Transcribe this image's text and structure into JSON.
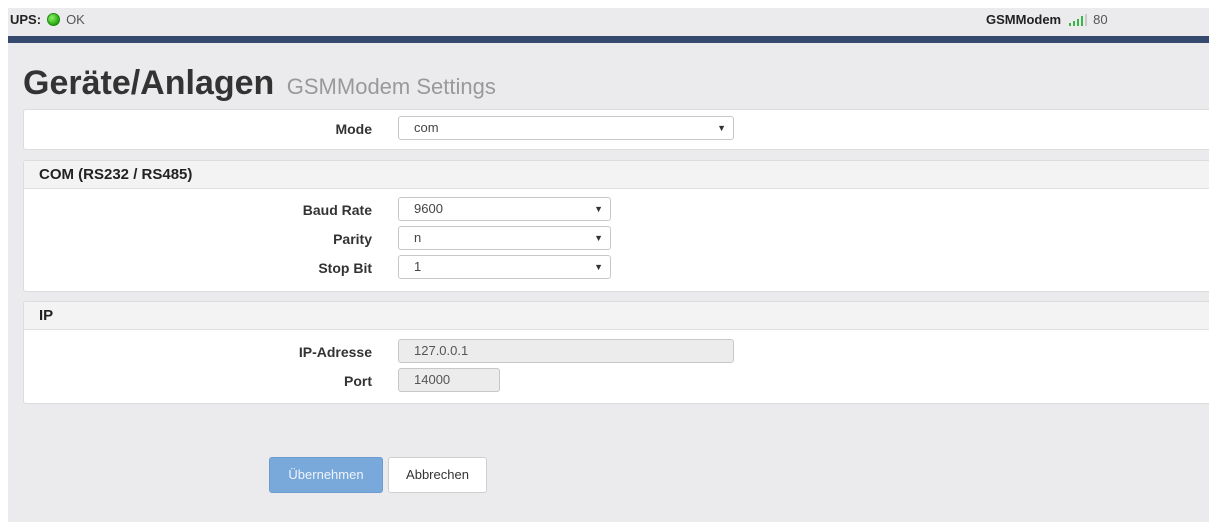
{
  "topbar": {
    "ups_label": "UPS:",
    "ups_status": "OK",
    "gsm_label": "GSMModem",
    "gsm_value": "80",
    "ups_status_color": "#27a80f",
    "signal_color": "#3ab54a",
    "navline_color": "#354a6e"
  },
  "page": {
    "title": "Geräte/Anlagen",
    "subtitle": "GSMModem Settings"
  },
  "mode": {
    "label": "Mode",
    "value": "com"
  },
  "com_section": {
    "heading": "COM (RS232 / RS485)",
    "baud_label": "Baud Rate",
    "baud_value": "9600",
    "parity_label": "Parity",
    "parity_value": "n",
    "stopbit_label": "Stop Bit",
    "stopbit_value": "1"
  },
  "ip_section": {
    "heading": "IP",
    "address_label": "IP-Adresse",
    "address_value": "127.0.0.1",
    "port_label": "Port",
    "port_value": "14000"
  },
  "buttons": {
    "apply_label": "Übernehmen",
    "cancel_label": "Abbrechen"
  },
  "icons": {
    "dropdown": "caret-down-icon",
    "status": "status-dot-icon",
    "signal": "signal-bars-icon"
  }
}
